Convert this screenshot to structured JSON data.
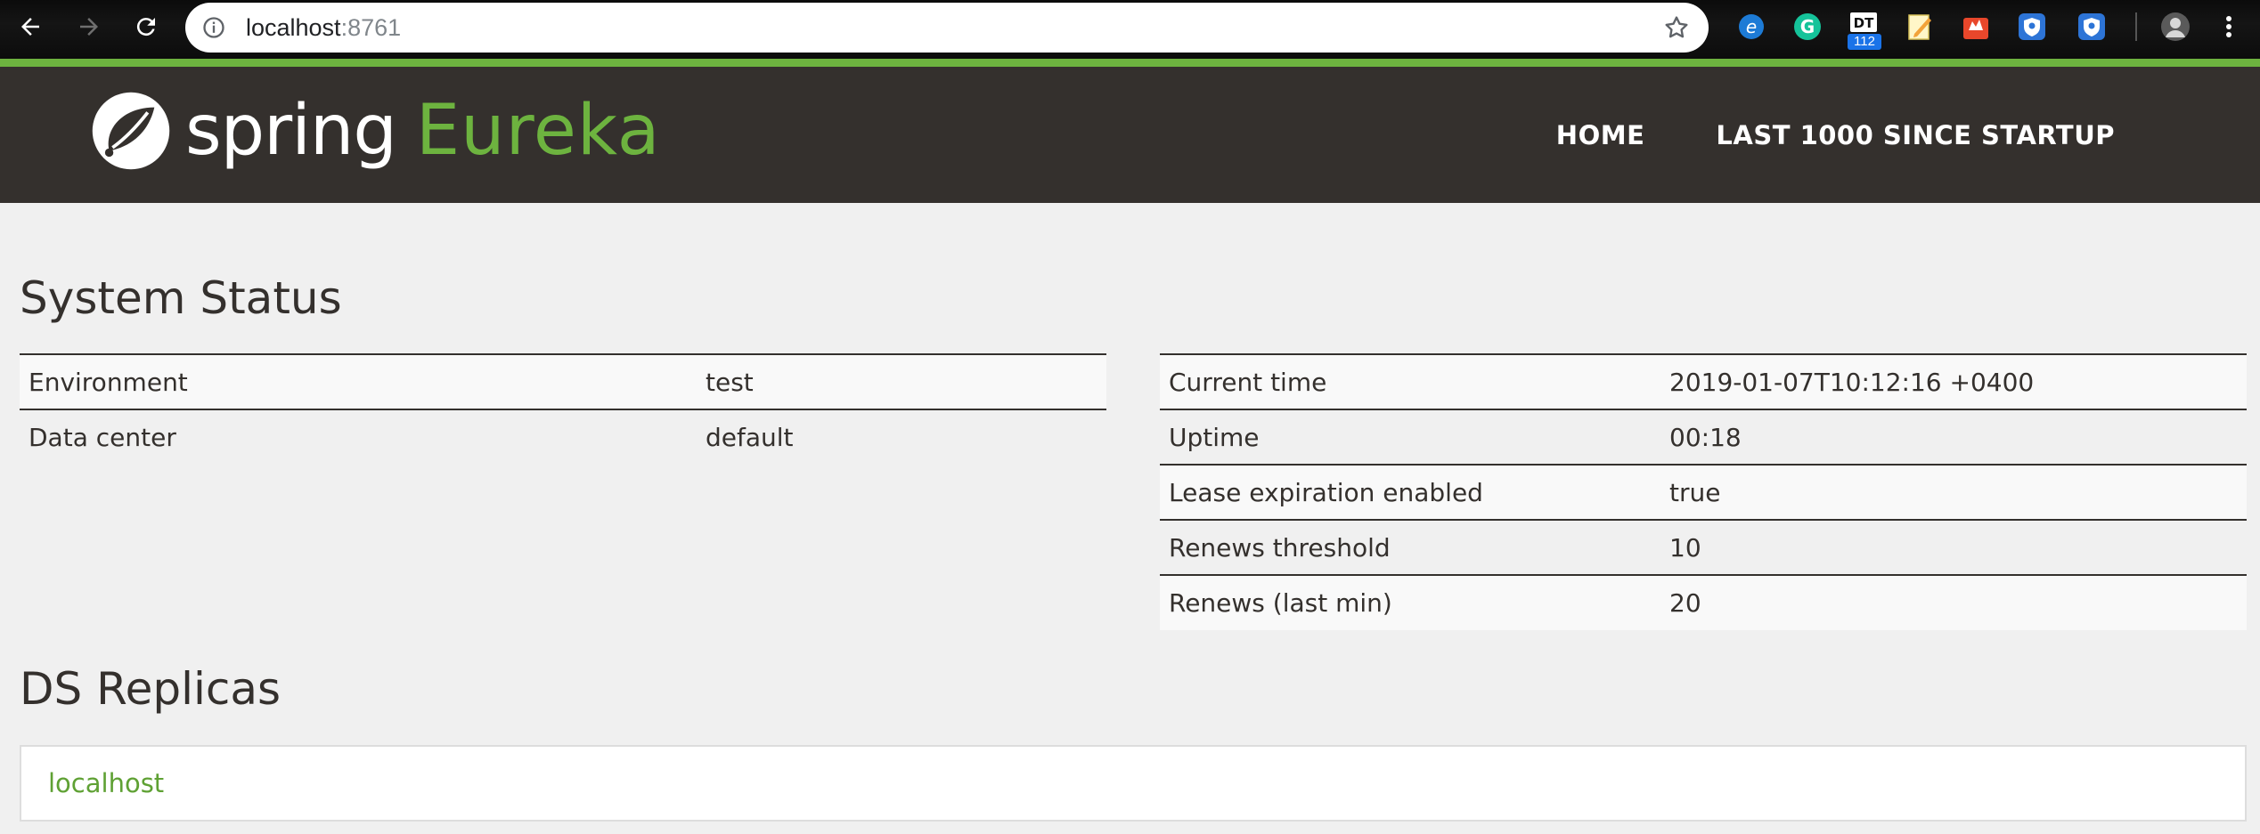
{
  "browser": {
    "url_host": "localhost",
    "url_port": ":8761",
    "extension_badge": "112",
    "icons": [
      "back-arrow-icon",
      "forward-arrow-icon",
      "reload-icon",
      "info-icon",
      "bookmark-star-icon",
      "ie-tab-extension-icon",
      "grammarly-extension-icon",
      "devtools-extension-icon",
      "notes-extension-icon",
      "tool-extension-icon",
      "shield-extension-icon",
      "shield-extension-icon",
      "profile-avatar-icon",
      "chrome-menu-icon"
    ]
  },
  "colors": {
    "spring_green": "#6db33f",
    "navbar_bg": "#34302d",
    "page_bg": "#f0f0f0",
    "link_green": "#5fa134"
  },
  "navbar": {
    "brand_spring": "spring",
    "brand_eureka": "Eureka",
    "links": [
      "HOME",
      "LAST 1000 SINCE STARTUP"
    ]
  },
  "system_status": {
    "title": "System Status",
    "left_rows": [
      {
        "key": "Environment",
        "value": "test"
      },
      {
        "key": "Data center",
        "value": "default"
      }
    ],
    "right_rows": [
      {
        "key": "Current time",
        "value": "2019-01-07T10:12:16 +0400"
      },
      {
        "key": "Uptime",
        "value": "00:18"
      },
      {
        "key": "Lease expiration enabled",
        "value": "true"
      },
      {
        "key": "Renews threshold",
        "value": "10"
      },
      {
        "key": "Renews (last min)",
        "value": "20"
      }
    ]
  },
  "ds_replicas": {
    "title": "DS Replicas",
    "items": [
      "localhost"
    ]
  }
}
